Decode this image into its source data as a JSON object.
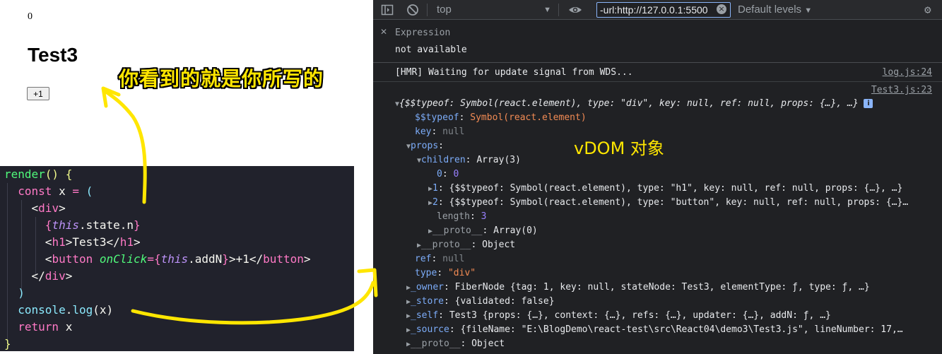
{
  "preview": {
    "counter": "0",
    "heading": "Test3",
    "button_label": "+1"
  },
  "annotations": {
    "rendered_note": "你看到的就是你所写的",
    "vdom_note": "vDOM 对象"
  },
  "code": {
    "lines": [
      "render() {",
      "  const x = (",
      "    <div>",
      "      {this.state.n}",
      "      <h1>Test3</h1>",
      "      <button onClick={this.addN}>+1</button>",
      "    </div>",
      "  )",
      "  console.log(x)",
      "  return x",
      "}"
    ]
  },
  "devtools": {
    "context": "top",
    "filter_value": "-url:http://127.0.0.1:5500",
    "levels": "Default levels",
    "expression_label": "Expression",
    "expression_value": "not available",
    "hmr_message": "[HMR] Waiting for update signal from WDS...",
    "hmr_source": "log.js:24",
    "log_source": "Test3.js:23",
    "summary": "{$$typeof: Symbol(react.element), type: \"div\", key: null, ref: null, props: {…}, …}",
    "tree": {
      "typeof_key": "$$typeof",
      "typeof_val": "Symbol(react.element)",
      "key_key": "key",
      "key_val": "null",
      "props_key": "props",
      "children_key": "children",
      "children_val": "Array(3)",
      "c0_key": "0",
      "c0_val": "0",
      "c1_key": "1",
      "c1_val": "{$$typeof: Symbol(react.element), type: \"h1\", key: null, ref: null, props: {…}, …}",
      "c2_key": "2",
      "c2_val": "{$$typeof: Symbol(react.element), type: \"button\", key: null, ref: null, props: {…}…",
      "length_key": "length",
      "length_val": "3",
      "arr_proto_key": "__proto__",
      "arr_proto_val": "Array(0)",
      "props_proto_key": "__proto__",
      "props_proto_val": "Object",
      "ref_key": "ref",
      "ref_val": "null",
      "type_key": "type",
      "type_val": "\"div\"",
      "owner_key": "_owner",
      "owner_val": "FiberNode {tag: 1, key: null, stateNode: Test3, elementType: ƒ, type: ƒ, …}",
      "store_key": "_store",
      "store_val": "{validated: false}",
      "self_key": "_self",
      "self_val": "Test3 {props: {…}, context: {…}, refs: {…}, updater: {…}, addN: ƒ, …}",
      "source_key": "_source",
      "source_val": "{fileName: \"E:\\BlogDemo\\react-test\\src\\React04\\demo3\\Test3.js\", lineNumber: 17,…",
      "obj_proto_key": "__proto__",
      "obj_proto_val": "Object"
    }
  },
  "colors": {
    "annotation": "#ffe600",
    "code_bg": "#21222c",
    "devtools_bg": "#202124"
  }
}
